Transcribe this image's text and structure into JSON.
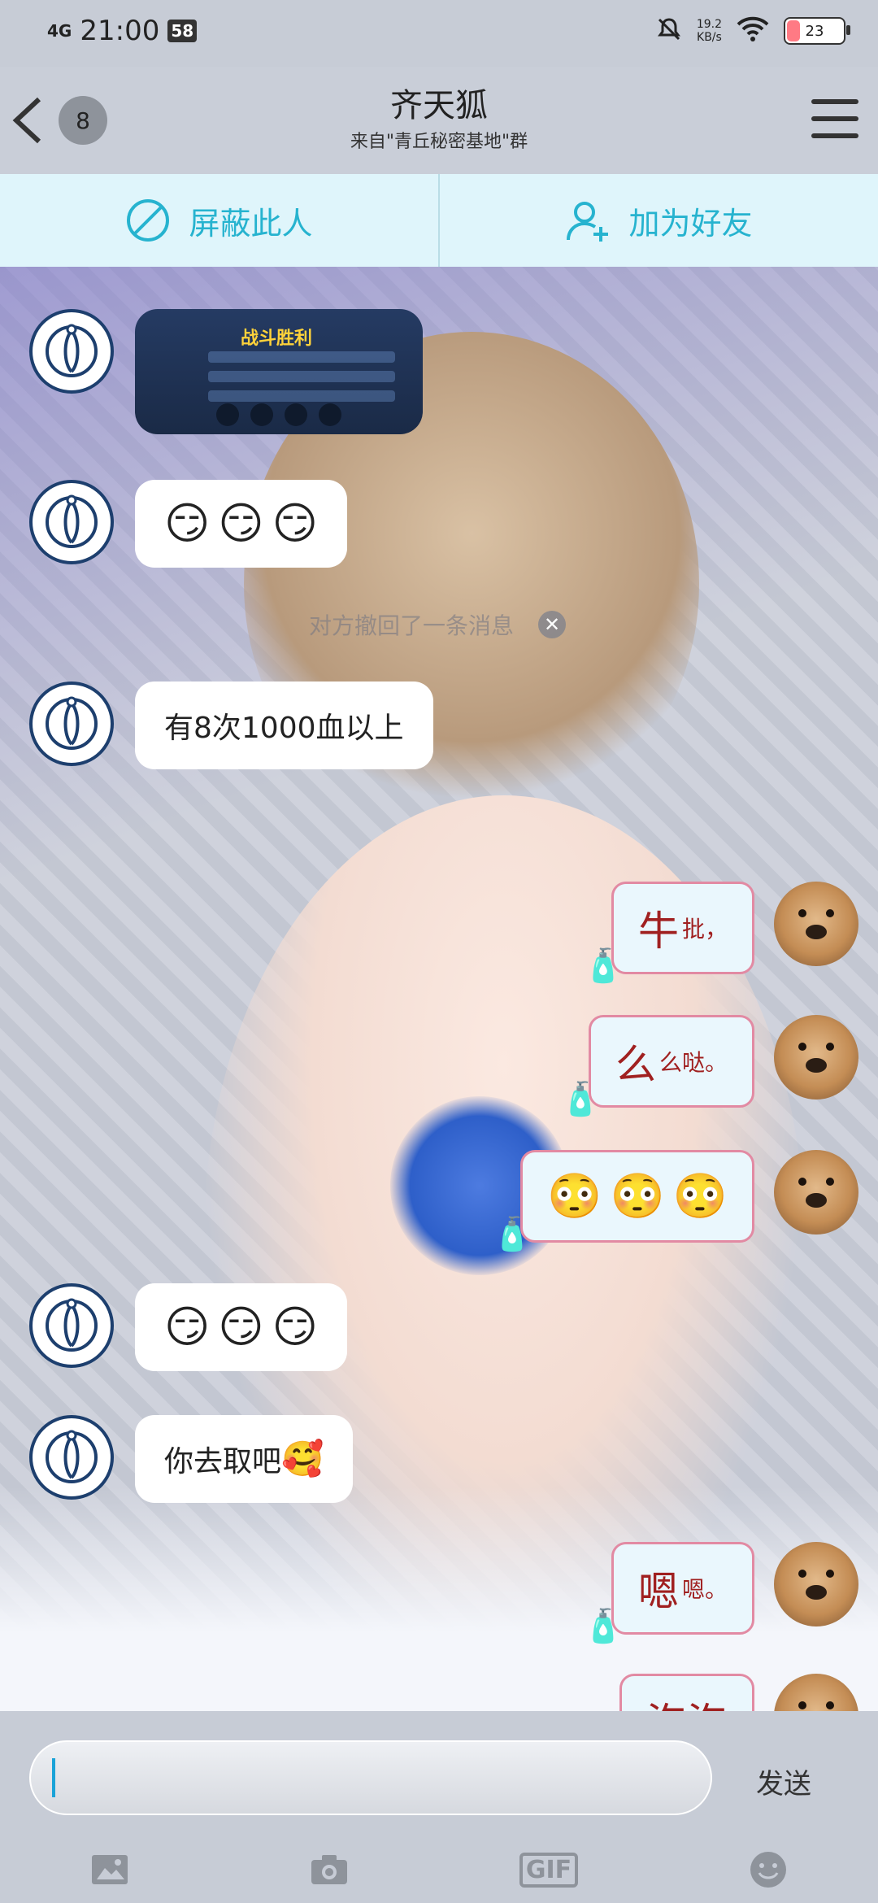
{
  "status_bar": {
    "network": "4G",
    "time": "21:00",
    "badge": "58",
    "speed_value": "19.2",
    "speed_unit": "KB/s",
    "battery": "23"
  },
  "header": {
    "back_icon": "chevron-left-icon",
    "count_badge": "8",
    "title": "齐天狐",
    "subtitle": "来自\"青丘秘密基地\"群",
    "menu_icon": "menu-icon"
  },
  "actions": {
    "block_label": "屏蔽此人",
    "add_friend_label": "加为好友"
  },
  "chat": {
    "hint": "对方撤回了一条消息",
    "messages": [
      {
        "side": "left",
        "type": "image",
        "image_title": "战斗胜利"
      },
      {
        "side": "left",
        "type": "emoji",
        "emojis": [
          "😏",
          "😏",
          "😏"
        ]
      },
      {
        "side": "left",
        "type": "text",
        "text": "有8次1000血以上"
      },
      {
        "side": "right",
        "type": "text",
        "text": "牛",
        "small": "批，"
      },
      {
        "side": "right",
        "type": "text",
        "text": "么",
        "small": "么哒。"
      },
      {
        "side": "right",
        "type": "emoji",
        "emojis": [
          "😳",
          "😳",
          "😳"
        ]
      },
      {
        "side": "left",
        "type": "emoji",
        "emojis": [
          "😏",
          "😏",
          "😏"
        ]
      },
      {
        "side": "left",
        "type": "text",
        "text": "你去取吧",
        "emoji": "🥰"
      },
      {
        "side": "right",
        "type": "text",
        "text": "嗯",
        "small": "嗯。"
      },
      {
        "side": "right",
        "type": "text",
        "text": "泡泡",
        "small": ""
      }
    ]
  },
  "input": {
    "value": "",
    "send_label": "发送",
    "gif_label": "GIF"
  }
}
